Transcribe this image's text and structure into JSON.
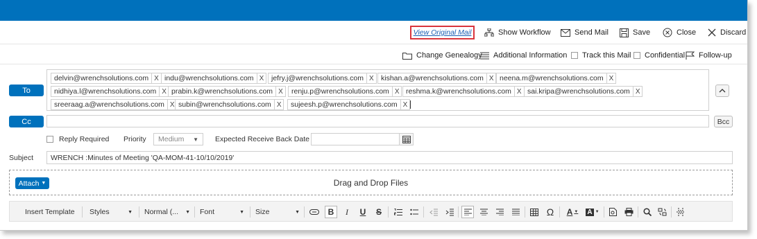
{
  "toolbar": {
    "view_original_mail": "View Original Mail",
    "show_workflow": "Show Workflow",
    "send_mail": "Send Mail",
    "save": "Save",
    "close": "Close",
    "discard": "Discard"
  },
  "toolbar2": {
    "change_genealogy": "Change Genealogy",
    "additional_information": "Additional Information",
    "track_this_mail": "Track this Mail",
    "confidential": "Confidential",
    "follow_up": "Follow-up"
  },
  "recipients": {
    "to_label": "To",
    "cc_label": "Cc",
    "bcc_label": "Bcc",
    "remove_label": "X",
    "to": [
      "delvin@wrenchsolutions.com",
      "indu@wrenchsolutions.com",
      "jefry.j@wrenchsolutions.com",
      "kishan.a@wrenchsolutions.com",
      "neena.m@wrenchsolutions.com",
      "nidhiya.l@wrenchsolutions.com",
      "prabin.k@wrenchsolutions.com",
      "renju.p@wrenchsolutions.com",
      "reshma.k@wrenchsolutions.com",
      "sai.kripa@wrenchsolutions.com",
      "sreeraag.a@wrenchsolutions.com",
      "subin@wrenchsolutions.com",
      "sujeesh.p@wrenchsolutions.com"
    ]
  },
  "options": {
    "reply_required": "Reply Required",
    "priority_label": "Priority",
    "priority_value": "Medium",
    "expected_receive_back_date": "Expected Receive Back Date"
  },
  "subject": {
    "label": "Subject",
    "value": "WRENCH :Minutes of Meeting 'QA-MOM-41-10/10/2019'"
  },
  "attach": {
    "button": "Attach",
    "drop_text": "Drag and Drop Files"
  },
  "editor": {
    "insert_template": "Insert Template",
    "styles": "Styles",
    "format": "Normal (...",
    "font": "Font",
    "size": "Size",
    "bold": "B",
    "italic": "I",
    "underline": "U",
    "strike": "S",
    "special_char": "Ω",
    "text_color": "A",
    "bg_color": "A"
  },
  "colors": {
    "header_blue": "#0071bc",
    "highlight_red": "#d9343c",
    "link_blue": "#1a5fb4"
  }
}
